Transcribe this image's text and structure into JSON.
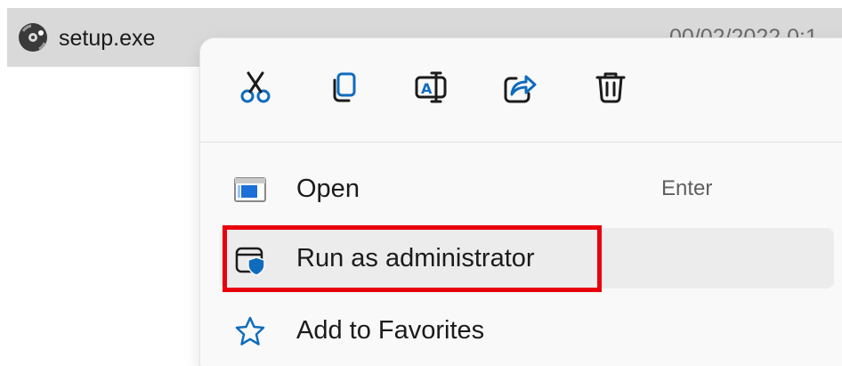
{
  "file": {
    "name": "setup.exe",
    "date_partial": "00/02/2022 0:1"
  },
  "context_menu": {
    "toolbar": [
      {
        "icon": "cut-icon",
        "label": "Cut"
      },
      {
        "icon": "copy-icon",
        "label": "Copy"
      },
      {
        "icon": "rename-icon",
        "label": "Rename"
      },
      {
        "icon": "share-icon",
        "label": "Share"
      },
      {
        "icon": "delete-icon",
        "label": "Delete"
      }
    ],
    "items": [
      {
        "icon": "open-app-icon",
        "label": "Open",
        "shortcut": "Enter"
      },
      {
        "icon": "run-as-admin-icon",
        "label": "Run as administrator",
        "shortcut": ""
      },
      {
        "icon": "star-icon",
        "label": "Add to Favorites",
        "shortcut": ""
      }
    ]
  },
  "colors": {
    "accent_blue": "#0f6cbd",
    "highlight_red": "#e8000d",
    "selection_gray": "#d9d9d9",
    "menu_bg": "#f9f9f9"
  }
}
